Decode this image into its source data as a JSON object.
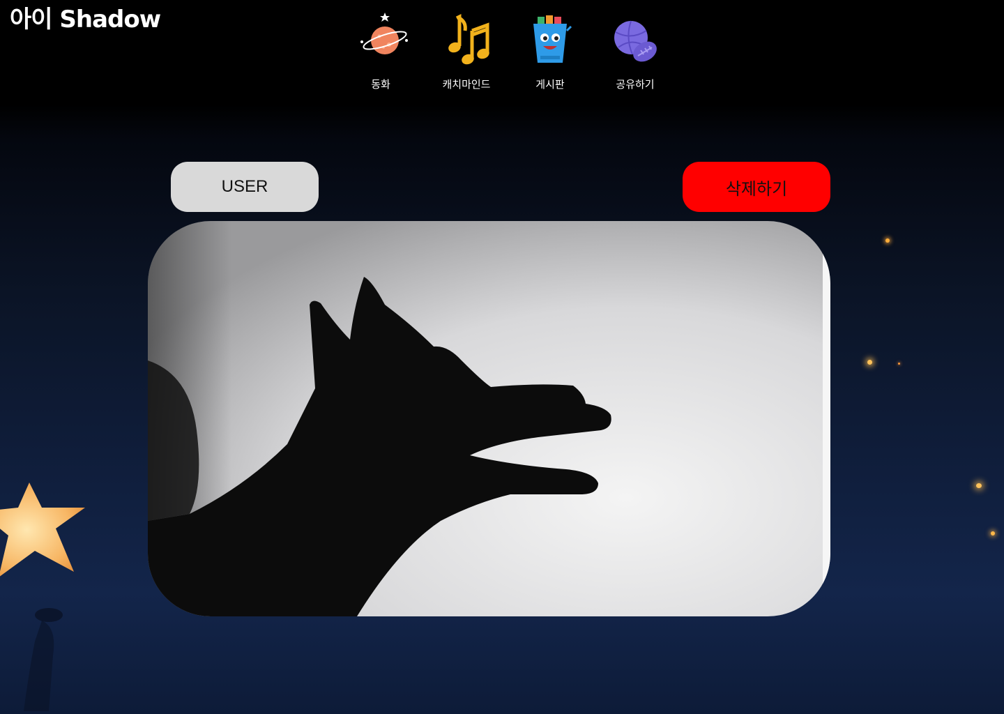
{
  "header": {
    "logo_text": "아이 Shadow",
    "nav": [
      {
        "label": "동화",
        "icon": "planet-icon"
      },
      {
        "label": "캐치마인드",
        "icon": "music-notes-icon"
      },
      {
        "label": "게시판",
        "icon": "popcorn-bucket-icon"
      },
      {
        "label": "공유하기",
        "icon": "balls-icon"
      }
    ]
  },
  "main": {
    "user_button": "USER",
    "delete_button": "삭제하기",
    "photo_alt": "hand shadow of a dog on a wall"
  },
  "colors": {
    "delete_button": "#ff0000",
    "user_button": "#d9d9d9",
    "background_top": "#000000",
    "background_bottom": "#0f1d3a"
  }
}
